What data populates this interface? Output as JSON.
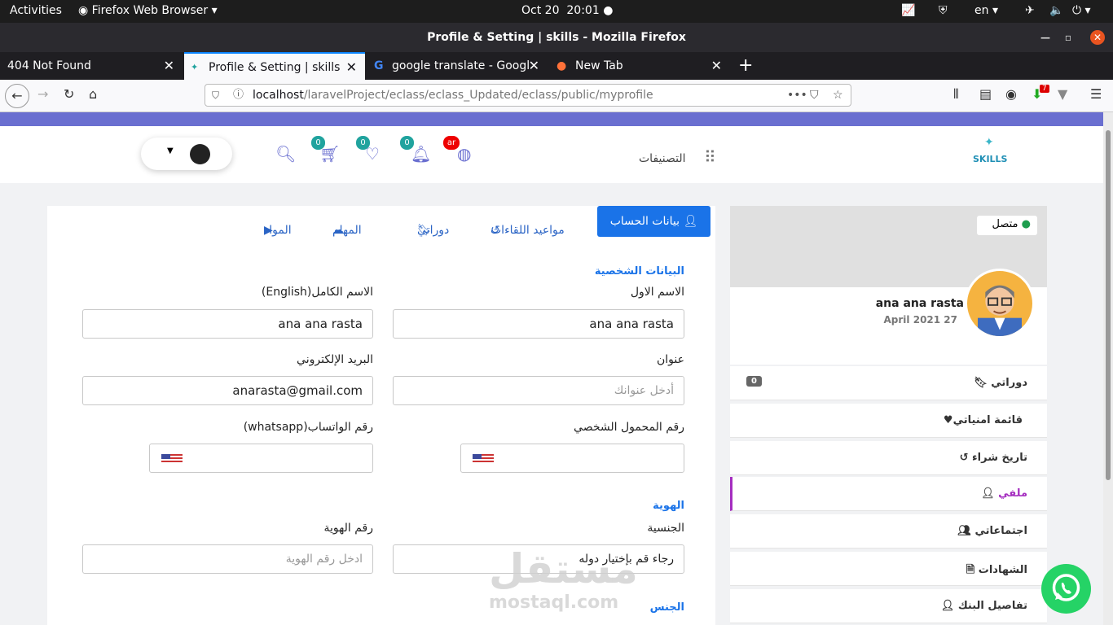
{
  "os_bar": {
    "activities": "Activities",
    "app": "Firefox Web Browser",
    "date": "Oct 20",
    "time": "20:01",
    "lang": "en"
  },
  "window": {
    "title": "Profile & Setting | skills - Mozilla Firefox"
  },
  "tabs": [
    {
      "label": "404 Not Found"
    },
    {
      "label": "Profile & Setting | skills"
    },
    {
      "label": "google translate - Googl"
    },
    {
      "label": "New Tab"
    }
  ],
  "url": {
    "host": "localhost",
    "path": "/laravelProject/eclass/eclass_Updated/eclass/public/myprofile",
    "ext_badge": "7"
  },
  "header": {
    "categories": "التصنيفات",
    "lang_badge": "ar",
    "notif_count": "0",
    "wish_count": "0",
    "cart_count": "0",
    "logo_text": "SKILLS"
  },
  "content_tabs": {
    "account": "بيانات الحساب",
    "meetings": "مواعيد اللقاءات",
    "courses": "دوراتي",
    "tasks": "المهام",
    "materials": "المواد"
  },
  "form": {
    "personal_section": "البيانات الشخصية",
    "first_name_label": "الاسم الاول",
    "first_name_value": "ana ana rasta",
    "full_name_label": "الاسم الكامل(English)",
    "full_name_value": "ana ana rasta",
    "address_label": "عنوان",
    "address_placeholder": "أدخل عنوانك",
    "email_label": "البريد الإلكتروني",
    "email_value": "anarasta@gmail.com",
    "mobile_label": "رقم المحمول الشخصي",
    "whatsapp_label": "رقم الواتساب(whatsapp)",
    "identity_section": "الهوية",
    "nationality_label": "الجنسية",
    "nationality_value": "رجاء قم بإختيار دوله",
    "id_label": "رقم الهوية",
    "id_placeholder": "ادخل رقم الهوية",
    "gender_section": "الجنس"
  },
  "profile": {
    "status": "متصل",
    "name": "ana ana rasta",
    "joined": "April 2021 27"
  },
  "menu": [
    {
      "label": "دوراتي",
      "count": "0"
    },
    {
      "label": "قائمة امنياتي"
    },
    {
      "label": "تاريخ شراء"
    },
    {
      "label": "ملفي"
    },
    {
      "label": "اجتماعاتي"
    },
    {
      "label": "الشهادات"
    },
    {
      "label": "تفاصيل البنك"
    }
  ],
  "watermark": {
    "ar": "مستقل",
    "en": "mostaql.com"
  },
  "colors": {
    "accent": "#6a6fd0",
    "primary": "#1a73e8",
    "active_menu": "#a52ec0"
  }
}
